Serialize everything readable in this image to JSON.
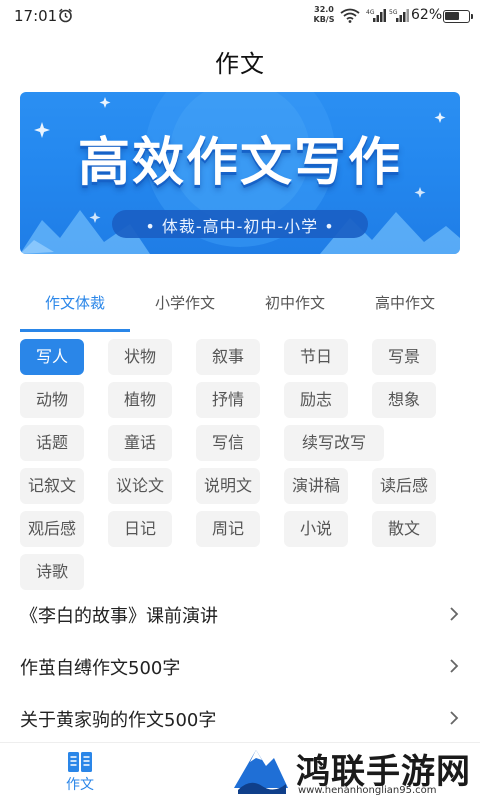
{
  "status_bar": {
    "time": "17:01",
    "speed_value": "32.0",
    "speed_unit": "KB/S",
    "net_label_1": "4G",
    "net_label_2": "5G",
    "battery_text": "62%",
    "battery_level": 0.62,
    "icons": [
      "alarm-icon",
      "wifi-icon",
      "signal-icon",
      "signal-icon",
      "battery-icon"
    ]
  },
  "header": {
    "title": "作文"
  },
  "banner": {
    "title": "高效作文写作",
    "subtitle": "• 体裁-高中-初中-小学 •",
    "colors": {
      "top": "#2b8ff2",
      "bottom": "#1f7de6"
    }
  },
  "tabs": [
    {
      "label": "作文体裁",
      "active": true
    },
    {
      "label": "小学作文",
      "active": false
    },
    {
      "label": "初中作文",
      "active": false
    },
    {
      "label": "高中作文",
      "active": false
    }
  ],
  "tags": [
    {
      "label": "写人",
      "active": true
    },
    {
      "label": "状物"
    },
    {
      "label": "叙事"
    },
    {
      "label": "节日"
    },
    {
      "label": "写景"
    },
    {
      "label": "动物"
    },
    {
      "label": "植物"
    },
    {
      "label": "抒情"
    },
    {
      "label": "励志"
    },
    {
      "label": "想象"
    },
    {
      "label": "话题"
    },
    {
      "label": "童话"
    },
    {
      "label": "写信"
    },
    {
      "label": "续写改写"
    },
    {
      "label": "记叙文"
    },
    {
      "label": "议论文"
    },
    {
      "label": "说明文"
    },
    {
      "label": "演讲稿"
    },
    {
      "label": "读后感"
    },
    {
      "label": "观后感"
    },
    {
      "label": "日记"
    },
    {
      "label": "周记"
    },
    {
      "label": "小说"
    },
    {
      "label": "散文"
    },
    {
      "label": "诗歌"
    }
  ],
  "articles": [
    {
      "title": "《李白的故事》课前演讲"
    },
    {
      "title": "作茧自缚作文500字"
    },
    {
      "title": "关于黄家驹的作文500字"
    }
  ],
  "bottom_nav": [
    {
      "label": "作文",
      "icon": "book-icon",
      "active": true
    }
  ],
  "watermark": {
    "text": "鸿联手游网",
    "url": "www.henanhonglian95.com"
  },
  "colors": {
    "accent": "#2a86e8",
    "tag_bg": "#f3f3f3",
    "text": "#222222"
  }
}
